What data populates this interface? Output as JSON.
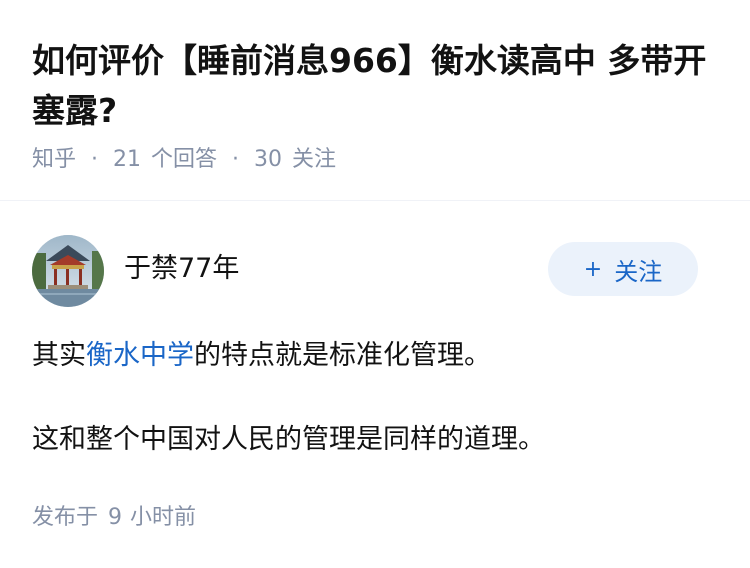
{
  "question": {
    "title": "如何评价【睡前消息966】衡水读高中 多带开塞露?",
    "source": "知乎",
    "answers_count": "21",
    "answers_label": "个回答",
    "followers_count": "30",
    "followers_label": "关注"
  },
  "author": {
    "name": "于禁77年",
    "avatar_icon": "avatar-pavilion-photo",
    "follow_plus": "+",
    "follow_label": "关注"
  },
  "answer": {
    "p1_before": "其实",
    "p1_link": "衡水中学",
    "p1_after": "的特点就是标准化管理。",
    "p2": "这和整个中国对人民的管理是同样的道理。"
  },
  "footer": {
    "publish_prefix": "发布于",
    "publish_number": "9",
    "publish_suffix": "小时前"
  },
  "colors": {
    "link": "#1a66c7",
    "meta": "#8590a6",
    "follow_bg": "#ebf2fb"
  }
}
